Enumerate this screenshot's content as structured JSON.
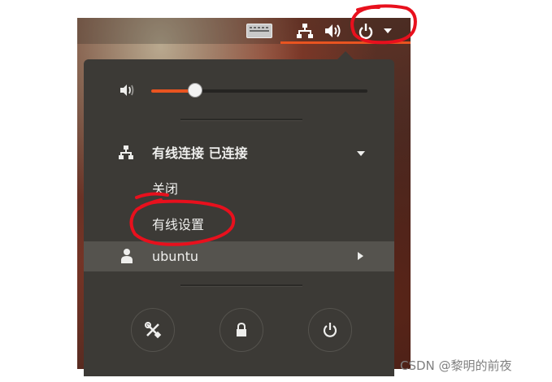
{
  "volume": {
    "level": 0.2
  },
  "network": {
    "title": "有线连接 已连接",
    "menu_items": [
      {
        "label": "关闭"
      },
      {
        "label": "有线设置"
      }
    ]
  },
  "user": {
    "name": "ubuntu"
  },
  "actions": {
    "icons": [
      "settings-icon",
      "lock-icon",
      "power-icon"
    ]
  },
  "colors": {
    "accent": "#e95420",
    "menu_bg": "#3c3a36",
    "annotation": "#e8101d"
  },
  "watermark": "CSDN @黎明的前夜"
}
